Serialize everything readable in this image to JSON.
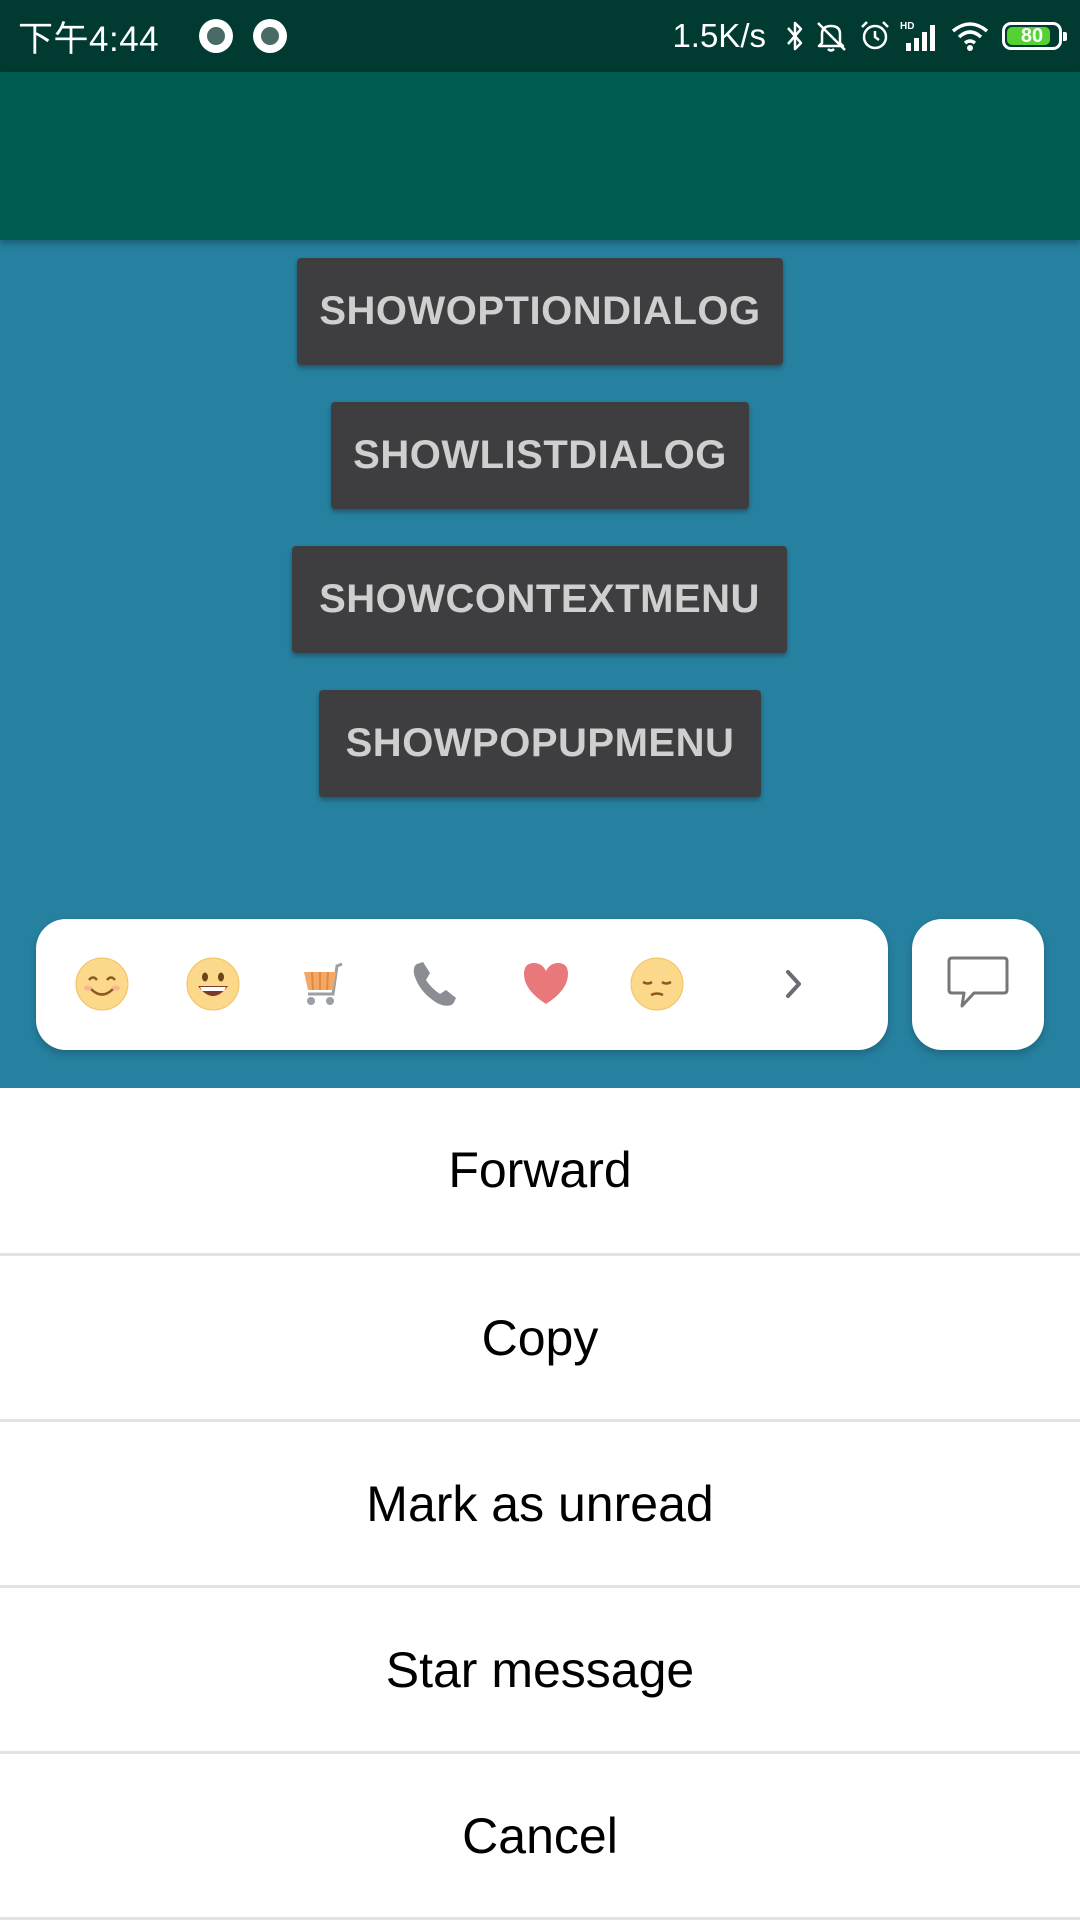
{
  "status_bar": {
    "time": "下午4:44",
    "network_speed": "1.5K/s",
    "battery_level": "80",
    "icons": [
      "notification-dot-icon",
      "notification-dot-icon",
      "bluetooth-icon",
      "mute-icon",
      "alarm-icon",
      "hd-signal-icon",
      "wifi-icon",
      "battery-icon"
    ]
  },
  "buttons": {
    "show_option_dialog": "SHOWOPTIONDIALOG",
    "show_list_dialog": "SHOWLISTDIALOG",
    "show_context_menu": "SHOWCONTEXTMENU",
    "show_popup_menu": "SHOWPOPUPMENU"
  },
  "emoji_bar": {
    "items": [
      "smiling-face-icon",
      "grinning-face-icon",
      "shopping-cart-icon",
      "phone-icon",
      "heart-icon",
      "pensive-face-icon"
    ],
    "more_icon": "chevron-right-icon"
  },
  "chat_button_icon": "chat-bubble-icon",
  "bottom_sheet": {
    "items": [
      "Forward",
      "Copy",
      "Mark as unread",
      "Star message",
      "Cancel"
    ]
  },
  "colors": {
    "status_bar": "#003a31",
    "app_bar": "#005c50",
    "content_bg": "#2680a0",
    "button_bg": "#3e3e40",
    "button_text": "#cfcfcf"
  }
}
